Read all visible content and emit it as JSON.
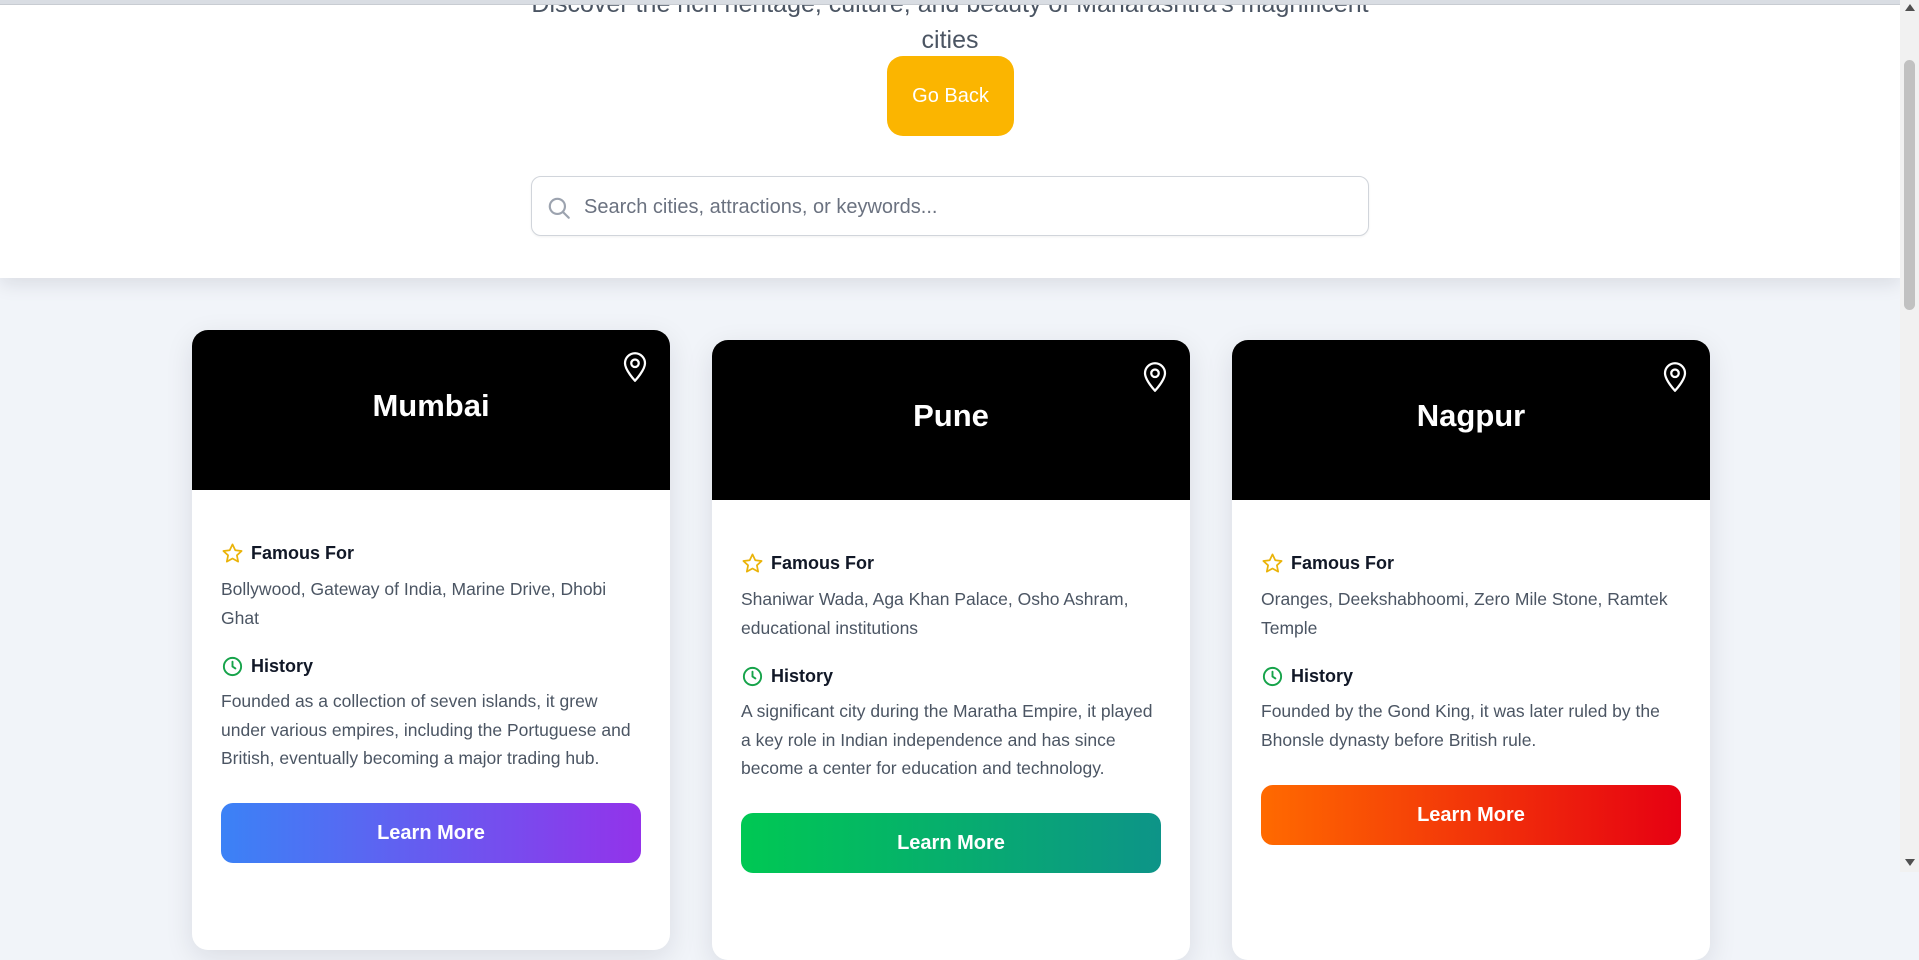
{
  "header": {
    "subtitle": "Discover the rich heritage, culture, and beauty of Maharashtra's magnificent cities",
    "back_label": "Go Back"
  },
  "search": {
    "placeholder": "Search cities, attractions, or keywords...",
    "icon": "search-icon"
  },
  "labels": {
    "famous": "Famous For",
    "history": "History"
  },
  "cards": [
    {
      "name": "Mumbai",
      "famous": "Bollywood, Gateway of India, Marine Drive, Dhobi Ghat",
      "history": "Founded as a collection of seven islands, it grew under various empires, including the Portuguese and British, eventually becoming a major trading hub.",
      "button": "Learn More",
      "gradient": [
        "#3b82f6",
        "#9333ea"
      ]
    },
    {
      "name": "Pune",
      "famous": "Shaniwar Wada, Aga Khan Palace, Osho Ashram, educational institutions",
      "history": "A significant city during the Maratha Empire, it played a key role in Indian independence and has since become a center for education and technology.",
      "button": "Learn More",
      "gradient": [
        "#00c853",
        "#0d9488"
      ]
    },
    {
      "name": "Nagpur",
      "famous": "Oranges, Deekshabhoomi, Zero Mile Stone, Ramtek Temple",
      "history": "Founded by the Gond King, it was later ruled by the Bhonsle dynasty before British rule.",
      "button": "Learn More",
      "gradient": [
        "#ff6a00",
        "#e60012"
      ]
    }
  ],
  "colors": {
    "accent_yellow": "#fbb500",
    "star": "#eab308",
    "clock": "#16a34a"
  }
}
